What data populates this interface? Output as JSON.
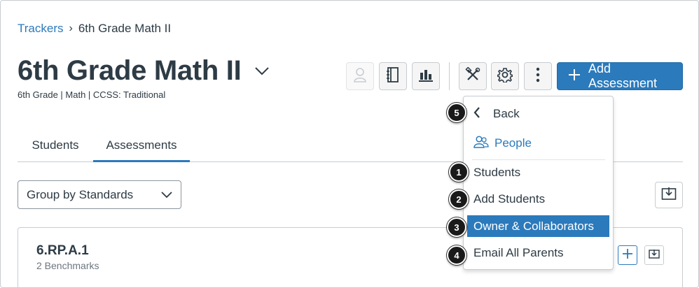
{
  "breadcrumb": {
    "parent": "Trackers",
    "separator": "›",
    "current": "6th Grade Math II"
  },
  "header": {
    "title": "6th Grade Math II",
    "subtitle": "6th Grade  |  Math  |  CCSS: Traditional"
  },
  "toolbar": {
    "add_label": "Add Assessment",
    "icons": [
      "person-icon",
      "gradebook-icon",
      "bar-chart-icon",
      "tools-icon",
      "gear-icon",
      "more-vertical-icon",
      "plus-icon"
    ]
  },
  "tabs": [
    {
      "label": "Students",
      "active": false
    },
    {
      "label": "Assessments",
      "active": true
    }
  ],
  "group_select": {
    "value": "Group by Standards"
  },
  "card": {
    "title": "6.RP.A.1",
    "subtitle": "2 Benchmarks"
  },
  "menu": {
    "back_label": "Back",
    "people_label": "People",
    "items": [
      {
        "label": "Students",
        "selected": false
      },
      {
        "label": "Add Students",
        "selected": false
      },
      {
        "label": "Owner & Collaborators",
        "selected": true
      },
      {
        "label": "Email All Parents",
        "selected": false
      }
    ]
  },
  "callouts": [
    "5",
    "1",
    "2",
    "3",
    "4"
  ],
  "colors": {
    "accent": "#2b7abc",
    "text": "#2d3b45",
    "border": "#c7cdd1",
    "callout": "#1a1a1a"
  }
}
